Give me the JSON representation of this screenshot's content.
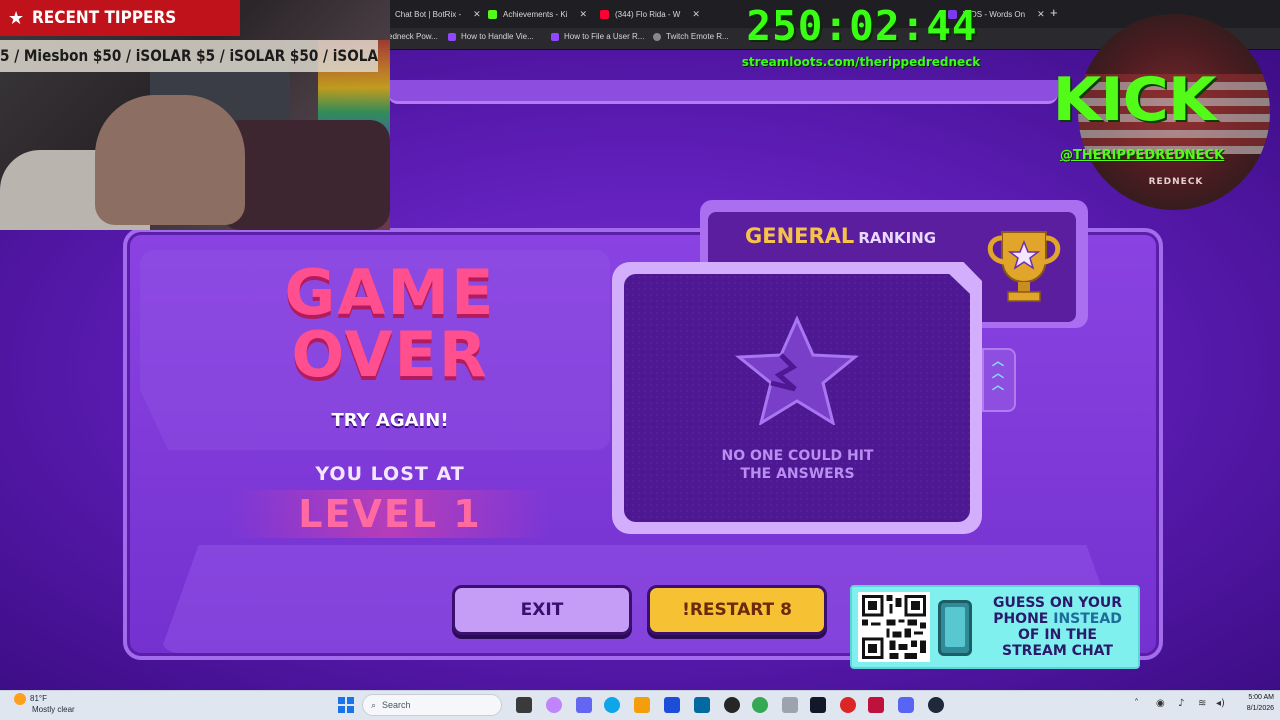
{
  "browser": {
    "tabs": [
      {
        "label": "Chat Bot | BotRix -",
        "color": "#7c3aed"
      },
      {
        "label": "Achievements - Ki",
        "color": "#53fc18"
      },
      {
        "label": "(344) Flo Rida - W",
        "color": "#ff0033"
      },
      {
        "label": "WOS - Words On",
        "color": "#7c3aed"
      }
    ],
    "bookmarks": [
      {
        "label": "edneck Pow..."
      },
      {
        "label": "How to Handle Vie..."
      },
      {
        "label": "How to File a User R..."
      },
      {
        "label": "Twitch Emote R..."
      }
    ]
  },
  "overlay": {
    "tippers_title": "RECENT TIPPERS",
    "ticker": "5 / Miesbon $50 / iSOLAR $5 / iSOLAR $50 / iSOLA",
    "timer": "250:02:44",
    "stream_link": "streamloots.com/therippedredneck",
    "kick_logo": "KICK",
    "kick_handle": "@THERIPPEDREDNECK",
    "badge_text": "REDNECK"
  },
  "game": {
    "title_line1": "GAME",
    "title_line2": "OVER",
    "try_again": "TRY AGAIN!",
    "lost_at": "YOU LOST AT",
    "level": "LEVEL 1",
    "ranking": {
      "highlight": "GENERAL",
      "label": "RANKING",
      "empty_line1": "NO ONE COULD HIT",
      "empty_line2": "THE ANSWERS"
    },
    "buttons": {
      "exit": "EXIT",
      "restart": "!RESTART 8"
    },
    "phone_banner": {
      "line1": "GUESS ON YOUR",
      "line2a": "PHONE",
      "line2b": "INSTEAD",
      "line3": "OF IN THE",
      "line4": "STREAM CHAT"
    },
    "colors": {
      "accent_pink": "#ff4f8f",
      "gold": "#f6c24a",
      "restart_yellow": "#f6c233",
      "exit_lilac": "#c59df7",
      "cyan_banner": "#7ff0ee"
    }
  },
  "taskbar": {
    "weather_temp": "81°F",
    "weather_desc": "Mostly clear",
    "search_placeholder": "Search",
    "time": "5:00 AM",
    "date": "8/1/2026"
  }
}
